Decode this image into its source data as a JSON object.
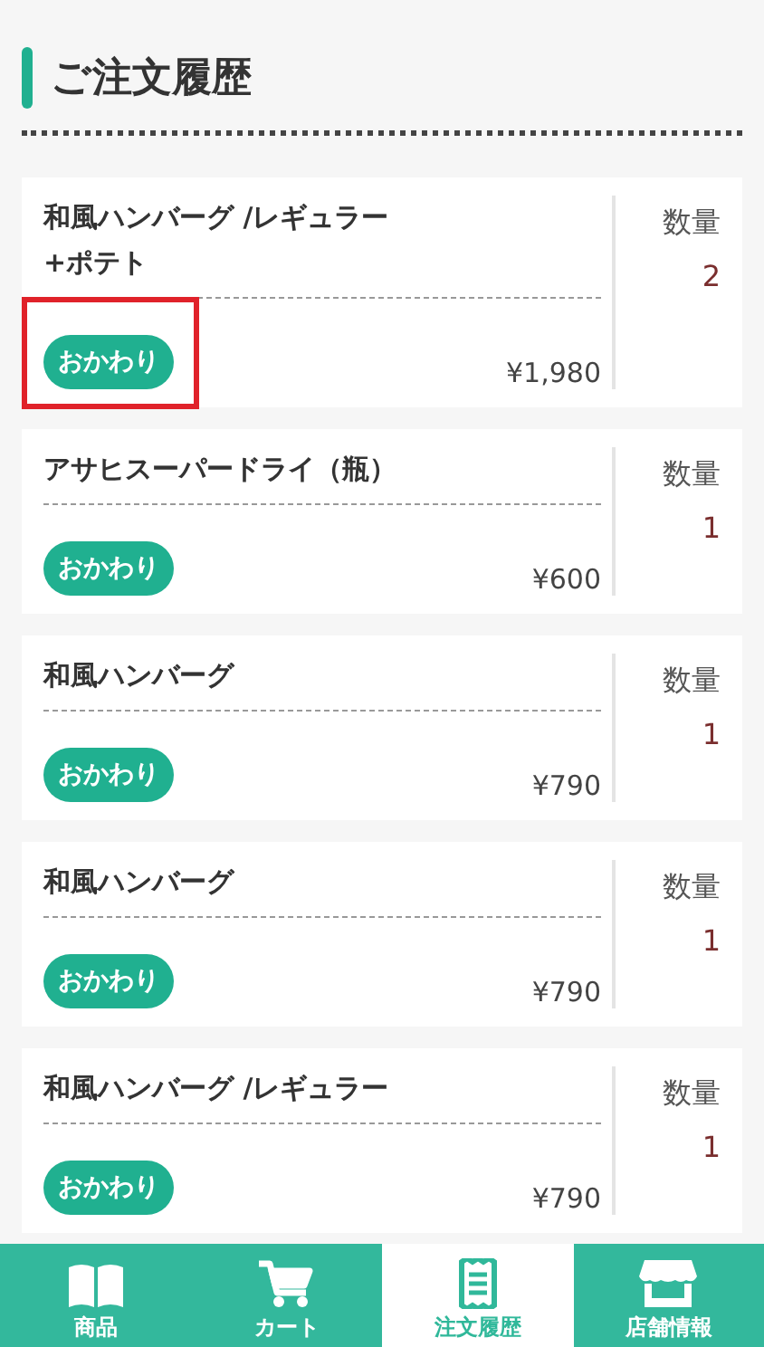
{
  "header": {
    "title": "ご注文履歴"
  },
  "orders": [
    {
      "name": "和風ハンバーグ /レギュラー\n+ポテト",
      "price": "¥1,980",
      "qty_label": "数量",
      "qty": "2",
      "button": "おかわり",
      "highlighted": true
    },
    {
      "name": "アサヒスーパードライ（瓶）",
      "price": "¥600",
      "qty_label": "数量",
      "qty": "1",
      "button": "おかわり",
      "highlighted": false
    },
    {
      "name": "和風ハンバーグ",
      "price": "¥790",
      "qty_label": "数量",
      "qty": "1",
      "button": "おかわり",
      "highlighted": false
    },
    {
      "name": "和風ハンバーグ",
      "price": "¥790",
      "qty_label": "数量",
      "qty": "1",
      "button": "おかわり",
      "highlighted": false
    },
    {
      "name": "和風ハンバーグ /レギュラー",
      "price": "¥790",
      "qty_label": "数量",
      "qty": "1",
      "button": "おかわり",
      "highlighted": false
    }
  ],
  "nav": [
    {
      "label": "商品",
      "selected": false
    },
    {
      "label": "カート",
      "selected": false
    },
    {
      "label": "注文履歴",
      "selected": true
    },
    {
      "label": "店舗情報",
      "selected": false
    }
  ]
}
